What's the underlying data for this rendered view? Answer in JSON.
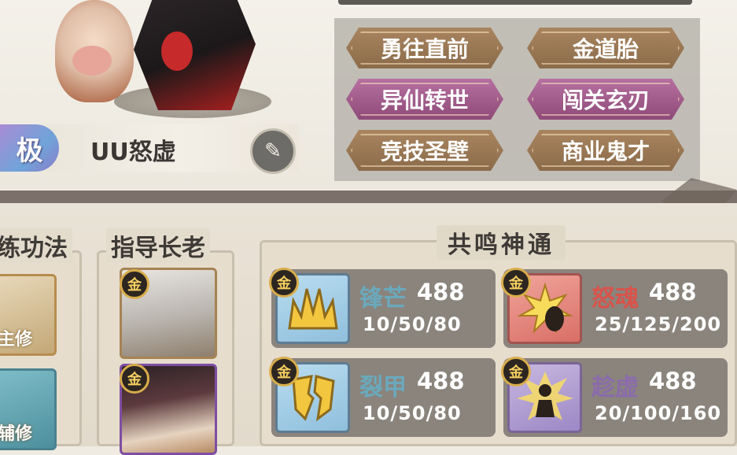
{
  "player": {
    "rank_label": "极",
    "name": "UU怒虚"
  },
  "titles": [
    {
      "label": "勇往直前",
      "style": "brown"
    },
    {
      "label": "金道胎",
      "style": "brown"
    },
    {
      "label": "异仙转世",
      "style": "purple"
    },
    {
      "label": "闯关玄刃",
      "style": "purple"
    },
    {
      "label": "竞技圣壁",
      "style": "brown"
    },
    {
      "label": "商业鬼才",
      "style": "brown"
    }
  ],
  "sections": {
    "lianfa": {
      "header": "练功法",
      "cards": [
        {
          "caption": "主修"
        },
        {
          "caption": "辅修"
        }
      ]
    },
    "elder": {
      "header": "指导长老",
      "cards": [
        {
          "badge": "金"
        },
        {
          "badge": "金"
        }
      ]
    },
    "resonance": {
      "header": "共鸣神通",
      "skills": [
        {
          "badge": "金",
          "name": "锋芒",
          "name_color": "#6aa9bd",
          "level": "488",
          "values": "10/50/80",
          "icon": "spike-crown-icon"
        },
        {
          "badge": "金",
          "name": "怒魂",
          "name_color": "#d9534a",
          "level": "488",
          "values": "25/125/200",
          "icon": "burst-shadow-icon"
        },
        {
          "badge": "金",
          "name": "裂甲",
          "name_color": "#6aa9bd",
          "level": "488",
          "values": "10/50/80",
          "icon": "broken-shield-icon"
        },
        {
          "badge": "金",
          "name": "趁虚",
          "name_color": "#8b6bab",
          "level": "488",
          "values": "20/100/160",
          "icon": "figure-glow-icon"
        }
      ]
    }
  }
}
